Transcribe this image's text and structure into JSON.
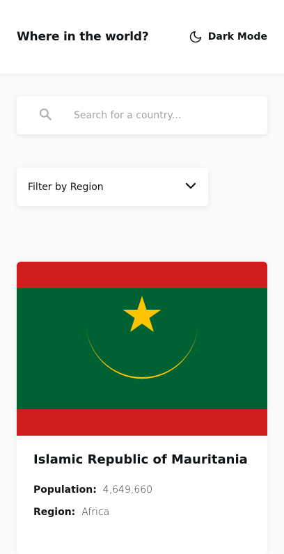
{
  "header": {
    "title": "Where in the world?",
    "theme_toggle_label": "Dark Mode",
    "theme_icon": "moon-icon"
  },
  "search": {
    "placeholder": "Search for a country...",
    "value": "",
    "icon": "search-icon"
  },
  "filter": {
    "label": "Filter by Region",
    "icon": "chevron-down-icon"
  },
  "countries": [
    {
      "name": "Islamic Republic of Mauritania",
      "population_label": "Population:",
      "population": "4,649,660",
      "region_label": "Region:",
      "region": "Africa",
      "flag": {
        "green": "#006233",
        "red": "#d01c1f",
        "gold": "#ffc400"
      }
    }
  ],
  "colors": {
    "background": "#fafafa",
    "surface": "#ffffff",
    "text": "#111517"
  }
}
